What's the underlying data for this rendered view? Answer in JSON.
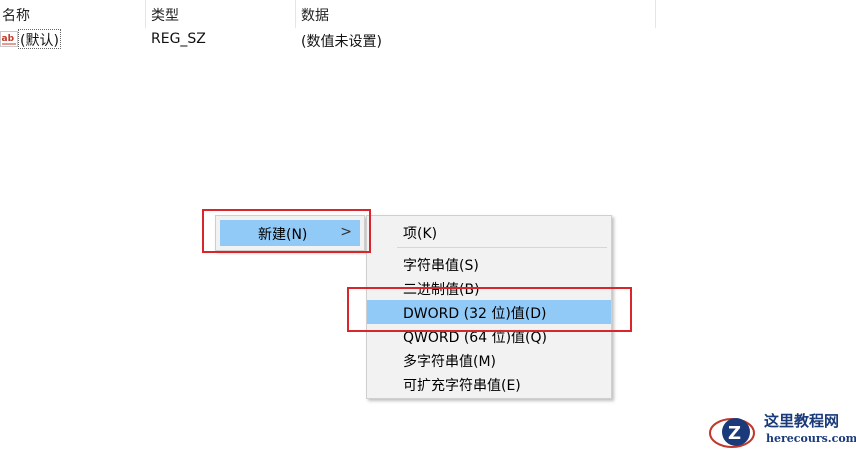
{
  "columns": {
    "name": "名称",
    "type": "类型",
    "data": "数据"
  },
  "rows": [
    {
      "icon": "ab-string-icon",
      "name": "(默认)",
      "type": "REG_SZ",
      "data": "(数值未设置)"
    }
  ],
  "menu": {
    "new_label": "新建(N)",
    "submenu_arrow": ">"
  },
  "submenu": {
    "items": [
      {
        "label": "项(K)"
      },
      {
        "label": "字符串值(S)"
      },
      {
        "label": "二进制值(B)"
      },
      {
        "label": "DWORD (32 位)值(D)",
        "highlighted": true
      },
      {
        "label": "QWORD (64 位)值(Q)"
      },
      {
        "label": "多字符串值(M)"
      },
      {
        "label": "可扩充字符串值(E)"
      }
    ]
  },
  "colors": {
    "highlight": "#91c9f7",
    "annotation": "#d9262b",
    "watermark": "#1a3a7a"
  },
  "watermark": {
    "title": "这里教程网",
    "subtitle": "herecours.com"
  }
}
